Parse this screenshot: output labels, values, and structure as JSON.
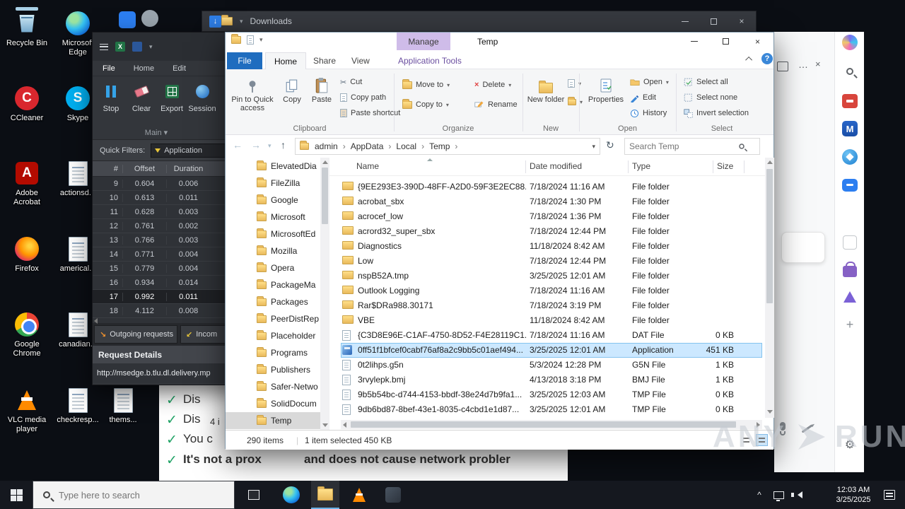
{
  "watermark": {
    "a": "ANY",
    "b": "RUN"
  },
  "desktop": {
    "col1": [
      "Recycle Bin",
      "CCleaner",
      "Adobe Acrobat",
      "Firefox",
      "Google Chrome",
      "VLC media player"
    ],
    "col2": [
      "Microsoft Edge",
      "Skype",
      "actionsd...",
      "americal...",
      "canadian...",
      "checkresp..."
    ],
    "col3": [
      "thems..."
    ]
  },
  "downloads": {
    "title": "Downloads"
  },
  "dbg": {
    "menu": [
      "File",
      "Home",
      "Edit"
    ],
    "buttons": [
      "Stop",
      "Clear",
      "Export",
      "Session"
    ],
    "group": "Main",
    "filters_label": "Quick Filters:",
    "filter_value": "Application",
    "columns": [
      "#",
      "Offset",
      "Duration"
    ],
    "rows": [
      {
        "n": "9",
        "o": "0.604",
        "d": "0.006"
      },
      {
        "n": "10",
        "o": "0.613",
        "d": "0.011"
      },
      {
        "n": "11",
        "o": "0.628",
        "d": "0.003"
      },
      {
        "n": "12",
        "o": "0.761",
        "d": "0.002"
      },
      {
        "n": "13",
        "o": "0.766",
        "d": "0.003"
      },
      {
        "n": "14",
        "o": "0.771",
        "d": "0.004"
      },
      {
        "n": "15",
        "o": "0.779",
        "d": "0.004"
      },
      {
        "n": "16",
        "o": "0.934",
        "d": "0.014"
      },
      {
        "n": "17",
        "o": "0.992",
        "d": "0.011"
      },
      {
        "n": "18",
        "o": "4.112",
        "d": "0.008"
      }
    ],
    "tab_out": "Outgoing requests",
    "tab_in": "Incom",
    "details": "Request Details",
    "url": "http://msedge.b.tlu.dl.delivery.mp"
  },
  "explorer": {
    "title": "Temp",
    "manage": "Manage",
    "app_tools": "Application Tools",
    "help": "?",
    "tabs": {
      "file": "File",
      "home": "Home",
      "share": "Share",
      "view": "View"
    },
    "ribbon": {
      "pin": "Pin to Quick access",
      "copy": "Copy",
      "paste": "Paste",
      "cut": "Cut",
      "copy_path": "Copy path",
      "paste_shortcut": "Paste shortcut",
      "g1": "Clipboard",
      "move_to": "Move to",
      "copy_to": "Copy to",
      "del": "Delete",
      "rename": "Rename",
      "g2": "Organize",
      "new_folder": "New folder",
      "g3": "New",
      "properties": "Properties",
      "open": "Open",
      "edit": "Edit",
      "history": "History",
      "g4": "Open",
      "select_all": "Select all",
      "select_none": "Select none",
      "invert": "Invert selection",
      "g5": "Select"
    },
    "crumbs": [
      "admin",
      "AppData",
      "Local",
      "Temp"
    ],
    "search_placeholder": "Search Temp",
    "columns": [
      "Name",
      "Date modified",
      "Type",
      "Size"
    ],
    "tree": [
      "ElevatedDia",
      "FileZilla",
      "Google",
      "Microsoft",
      "MicrosoftEd",
      "Mozilla",
      "Opera",
      "PackageMa",
      "Packages",
      "PeerDistRep",
      "Placeholder",
      "Programs",
      "Publishers",
      "Safer-Netwo",
      "SolidDocum",
      "Temp"
    ],
    "files": [
      {
        "n": "{9EE293E3-390D-48FF-A2D0-59F3E2EC88...",
        "d": "7/18/2024 11:16 AM",
        "t": "File folder",
        "s": ""
      },
      {
        "n": "acrobat_sbx",
        "d": "7/18/2024 1:30 PM",
        "t": "File folder",
        "s": ""
      },
      {
        "n": "acrocef_low",
        "d": "7/18/2024 1:36 PM",
        "t": "File folder",
        "s": ""
      },
      {
        "n": "acrord32_super_sbx",
        "d": "7/18/2024 12:44 PM",
        "t": "File folder",
        "s": ""
      },
      {
        "n": "Diagnostics",
        "d": "11/18/2024 8:42 AM",
        "t": "File folder",
        "s": ""
      },
      {
        "n": "Low",
        "d": "7/18/2024 12:44 PM",
        "t": "File folder",
        "s": ""
      },
      {
        "n": "nspB52A.tmp",
        "d": "3/25/2025 12:01 AM",
        "t": "File folder",
        "s": ""
      },
      {
        "n": "Outlook Logging",
        "d": "7/18/2024 11:16 AM",
        "t": "File folder",
        "s": ""
      },
      {
        "n": "Rar$DRa988.30171",
        "d": "7/18/2024 3:19 PM",
        "t": "File folder",
        "s": ""
      },
      {
        "n": "VBE",
        "d": "11/18/2024 8:42 AM",
        "t": "File folder",
        "s": ""
      },
      {
        "n": "{C3D8E96E-C1AF-4750-8D52-F4E28119C1...",
        "d": "7/18/2024 11:16 AM",
        "t": "DAT File",
        "s": "0 KB"
      },
      {
        "n": "0ff51f1bfcef0cabf76af8a2c9bb5c01aef494...",
        "d": "3/25/2025 12:01 AM",
        "t": "Application",
        "s": "451 KB"
      },
      {
        "n": "0t2lihps.g5n",
        "d": "5/3/2024 12:28 PM",
        "t": "G5N File",
        "s": "1 KB"
      },
      {
        "n": "3rvylepk.bmj",
        "d": "4/13/2018 3:18 PM",
        "t": "BMJ File",
        "s": "1 KB"
      },
      {
        "n": "9b5b54bc-d744-4153-bbdf-38e24d7b9fa1...",
        "d": "3/25/2025 12:03 AM",
        "t": "TMP File",
        "s": "0 KB"
      },
      {
        "n": "9db6bd87-8bef-43e1-8035-c4cbd1e1d87...",
        "d": "3/25/2025 12:01 AM",
        "t": "TMP File",
        "s": "0 KB"
      }
    ],
    "status_items": "290 items",
    "status_selected": "1 item selected",
    "status_size": "450 KB"
  },
  "web": {
    "check_glyph": "✓",
    "l1": "Dis",
    "l2": "Dis",
    "l2b": "4 i",
    "l3": "You c",
    "l4a": "It's not a prox",
    "l4b": "and does not cause network probler"
  },
  "task": {
    "search_placeholder": "Type here to search",
    "time": "12:03 AM",
    "date": "3/25/2025"
  }
}
